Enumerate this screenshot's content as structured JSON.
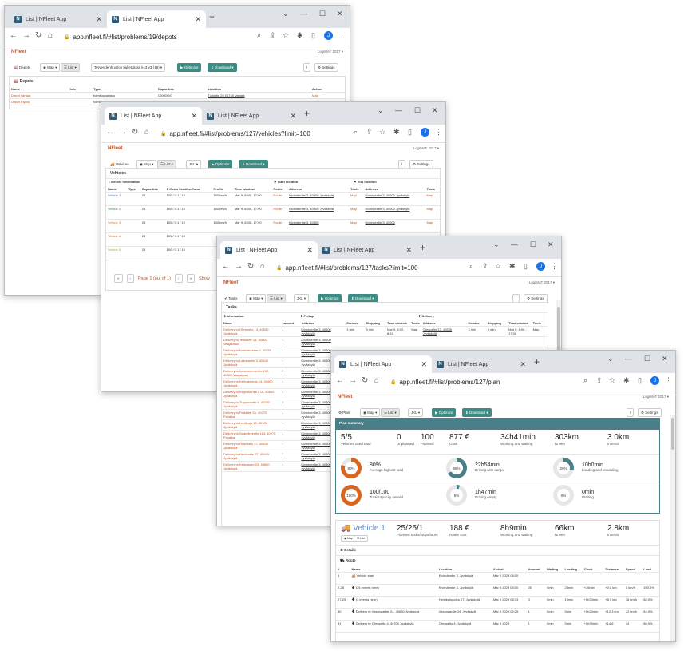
{
  "browser": {
    "tab_title": "List | NFleet App",
    "new_tab": "+",
    "minimize": "—",
    "maximize": "☐",
    "close": "✕"
  },
  "app": {
    "logo": "NFleet",
    "user": "LogiMAT 2017 ▾"
  },
  "toolbar": {
    "map": "◉ Map ▾",
    "list": "☰ List ▾",
    "optimize": "▶ Optimize",
    "download": "⬇ Download ▾",
    "info": "!",
    "settings": "⚙ Settings",
    "jkl": "JKL ▾"
  },
  "w1": {
    "url": "app.nfleet.fi/#list/problems/19/depots",
    "view": "🏭 Depots",
    "dropdown": "Terveydenhuollon kuljetuksia n=3 v3 (19) ▾",
    "section": "🏭 Depots",
    "headers": [
      "Name",
      "Info",
      "Type",
      "Capacities",
      "Location",
      "Action"
    ],
    "rows": [
      [
        "Depot Vantaa",
        "",
        "toimitusvarasto",
        "10000/0/0",
        "Tuikintie 25 01740 Vantaa",
        "Map"
      ],
      [
        "Depot Espoo",
        "",
        "toimi...",
        "",
        "",
        ""
      ]
    ]
  },
  "w2": {
    "url": "app.nfleet.fi/#list/problems/127/vehicles?limit=100",
    "view": "🚚 Vehicles",
    "section": "Vehicles",
    "group_info": "ℹ Vehicle information",
    "group_start": "⚑ Start location",
    "group_end": "⚑ End location",
    "headers": [
      "Name",
      "Type",
      "Capacities",
      "€ Costs fixed/km/hour",
      "Profile",
      "Time window",
      "Route",
      "Address",
      "Tools",
      "Address",
      "Tools"
    ],
    "rows": [
      [
        "Vehicle 1",
        "",
        "25",
        "100 / 0.1 / 10",
        "100 km/h",
        "Mar 9, 8:00 - 17:00",
        "Route",
        "Kivimäentie 3, 40500 Jyväskylä",
        "Map",
        "Kivimäentie 3, 40500 Jyväskylä",
        "Map"
      ],
      [
        "Vehicle 2",
        "",
        "25",
        "100 / 0.1 / 10",
        "100 km/h",
        "Mar 9, 8:00 - 17:00",
        "Route",
        "Kivimäentie 3, 40500 Jyväskylä",
        "Map",
        "Kivimäentie 3, 40500 Jyväskylä",
        "Map"
      ],
      [
        "Vehicle 3",
        "",
        "25",
        "100 / 0.1 / 10",
        "100 km/h",
        "Mar 9, 8:00 - 17:00",
        "Route",
        "Kivimäentie 3, 40500",
        "Map",
        "Kivimäentie 3, 40500",
        "Map"
      ],
      [
        "Vehicle 4",
        "",
        "25",
        "100 / 0.1 / 10",
        "",
        "",
        "",
        "",
        "",
        "",
        ""
      ],
      [
        "Vehicle 5",
        "",
        "25",
        "100 / 0.1 / 10",
        "",
        "",
        "",
        "",
        "",
        "",
        ""
      ]
    ],
    "pager_first": "«",
    "pager_prev": "‹",
    "pager_label": "Page 1 (out of 1)",
    "pager_next": "›",
    "pager_last": "»",
    "pager_show": "Show"
  },
  "w3": {
    "url": "app.nfleet.fi/#list/problems/127/tasks?limit=100",
    "view": "✔ Tasks",
    "section": "Tasks",
    "group_info": "ℹ Information",
    "group_pickup": "✚ Pickup",
    "group_delivery": "✚ Delivery",
    "headers": [
      "Name",
      "Amount",
      "Address",
      "Service",
      "Stopping",
      "Time window",
      "Tools",
      "Address",
      "Service",
      "Stopping",
      "Time window",
      "Tools"
    ],
    "first_row": [
      "Delivery to Ohrapelto 13, 40530 Jyväskylä",
      "1",
      "Kivimäentie 3, 40500 Jyväskylä",
      "1 min",
      "0 min",
      "Mar 9, 8:00 - 8:15",
      "Map",
      "Ohrapelto 13, 40530 Jyväskylä",
      "3 min",
      "0 min",
      "Mar 9, 8:00 - 17:00",
      "Map"
    ],
    "names": [
      "Delivery to Tellkänte 13, 40800 Vaajakoski",
      "Delivery to Kalevanrinne 4, 40250 Jyväskylä",
      "Delivery to Laitokantie 3, 40640 Jyväskylä",
      "Delivery to Laurinniementie 190, 40800 Vaajakoski",
      "Delivery to Kerhokierros 14, 40400 Jyväskylä",
      "Delivery to Keljonkantie 27A, 40600 Jyväskylä",
      "Delivery to Tuppurantie 9, 40250 Jyväskylä",
      "Delivery to Palkintie 23, 40270 Palokka",
      "Delivery to Luhtikuja 12, 40100 Jyväskylä",
      "Delivery to Saarijärventie 114, 40270 Palokka",
      "Delivery to Oravikatu 27, 40640 Jyväskylä",
      "Delivery to Haukantie 27, 40640 Jyväskylä",
      "Delivery to Keljonkatu 23, 40600 Jyväskylä"
    ],
    "amount": "1",
    "address": "Kivimäentie 3, 40500 Jyväskylä"
  },
  "w4": {
    "url": "app.nfleet.fi/#list/problems/127/plan",
    "view": "⚙ Plan",
    "summary_title": "Plan summary",
    "stats": [
      {
        "value": "5/5",
        "label": "Vehicles used total"
      },
      {
        "value": "0",
        "label": "Unplanned"
      },
      {
        "value": "100",
        "label": "Planned"
      },
      {
        "value": "877 €",
        "label": "Cost"
      },
      {
        "value": "34h41min",
        "label": "Working and waiting"
      },
      {
        "value": "303km",
        "label": "Driven"
      },
      {
        "value": "3.0km",
        "label": "Interval"
      }
    ],
    "gauges": [
      {
        "pct": 80,
        "center": "80%",
        "value": "80%",
        "label": "Average highest load",
        "color": "#d9661f"
      },
      {
        "pct": 66,
        "center": "66%",
        "value": "22h54min",
        "label": "Driving with cargo",
        "color": "#4a7f8a"
      },
      {
        "pct": 29,
        "center": "29%",
        "value": "10h0min",
        "label": "Loading and unloading",
        "color": "#4a7f8a"
      },
      {
        "pct": 100,
        "center": "100%",
        "value": "100/100",
        "label": "Total capacity served",
        "color": "#d9661f"
      },
      {
        "pct": 5,
        "center": "5%",
        "value": "1h47min",
        "label": "Driving empty",
        "color": "#4a7f8a"
      },
      {
        "pct": 0,
        "center": "0%",
        "value": "0min",
        "label": "Waiting",
        "color": "#4a7f8a"
      }
    ],
    "vehicle": {
      "name": "🚚 Vehicle 1",
      "map": "◉ Map",
      "list": "☰ List",
      "stats": [
        {
          "value": "25/25/1",
          "label": "Planned tasks/stops/tours"
        },
        {
          "value": "188 €",
          "label": "Route cost"
        },
        {
          "value": "8h9min",
          "label": "Working and waiting"
        },
        {
          "value": "66km",
          "label": "Driven"
        },
        {
          "value": "2.8km",
          "label": "Interval"
        }
      ]
    },
    "details": "⚙ Details",
    "route": "⛟ Route",
    "route_headers": [
      "#",
      "Name",
      "Location",
      "Arrival",
      "Amount",
      "Waiting",
      "Loading",
      "Clock",
      "Distance",
      "Speed",
      "Load"
    ],
    "route_rows": [
      [
        "1",
        "🚚 Vehicle start",
        "Kivimäentie 3, Jyväskylä",
        "Mar 9 2023 08:00",
        "",
        "",
        "",
        "",
        "",
        "",
        ""
      ],
      [
        "2-26",
        "🡅 (25 events here)",
        "Kivimäentie 3, Jyväskylä",
        "Mar 9 2023 08:00",
        "25",
        "0min",
        "25min",
        "+25min",
        "+0.0 km",
        "0 km/h",
        "100.0%"
      ],
      [
        "27-29",
        "🡇 (3 events here)",
        "Heinikatupolku 27, Jyväskylä",
        "Mar 9 2023 08:33",
        "3",
        "0min",
        "15min",
        "+0h33min",
        "+8.5 km",
        "16 km/h",
        "88.0%"
      ],
      [
        "30",
        "🡇 Delivery to Vesangantie 24, 40630 Jyväskylä",
        "Vesangantie 24, Jyväskylä",
        "Mar 9 2023 09:25",
        "1",
        "0min",
        "5min",
        "+0h33min",
        "+12.3 km",
        "12 km/h",
        "84.0%"
      ],
      [
        "31",
        "🡇 Delivery to Ohrapelto 4, 40700 Jyväskylä",
        "Ohrapelto 4, Jyväskylä",
        "Mar 9 2023",
        "1",
        "0min",
        "5min",
        "+0h39min",
        "+14.6",
        "14",
        "80.0%"
      ]
    ]
  }
}
